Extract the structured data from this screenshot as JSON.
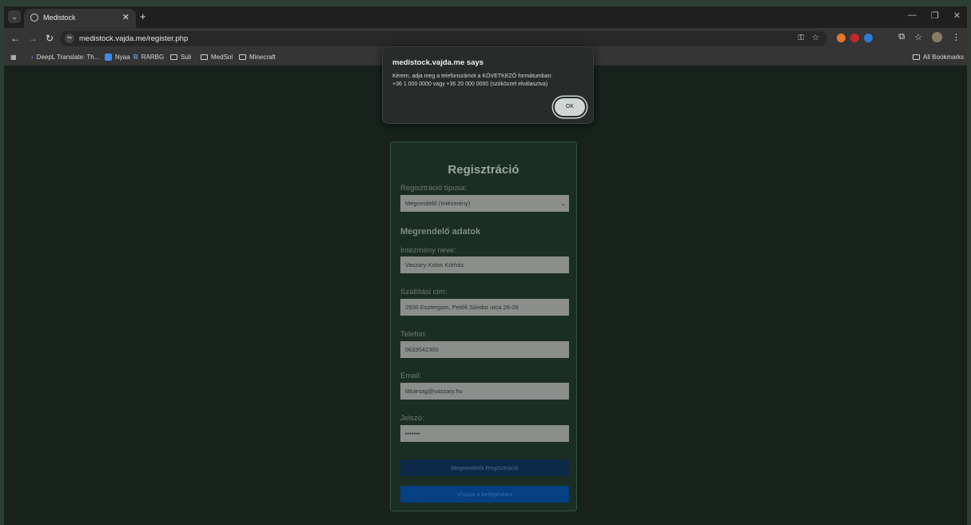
{
  "browser": {
    "tab": {
      "title": "Medistock",
      "close": "✕"
    },
    "new_tab": "+",
    "url": "medistock.vajda.me/register.php",
    "window_controls": [
      "—",
      "❐",
      "✕"
    ],
    "bookmarks": [
      "DeepL Translate: Th...",
      "Nyaa",
      "RARBG",
      "Suli",
      "MedSol",
      "Minecraft"
    ],
    "all_bookmarks": "All Bookmarks"
  },
  "dialog": {
    "title": "medistock.vajda.me says",
    "message_line1": "Kérem, adja meg a telefonszámot a KÖVETKEZŐ formátumban:",
    "message_line2": "+36 1 000 0000 vagy +36 20 000 0000 (szóközzel elválasztva)",
    "ok_label": "OK"
  },
  "form": {
    "title": "Regisztráció",
    "type_label": "Regisztráció típusa:",
    "type_value": "Megrendelő (Intézmény)",
    "section_title": "Megrendelő adatok",
    "institution_label": "Intézmény neve:",
    "institution_value": "Vaszary Kolos Kórház",
    "address_label": "Szállítási cím:",
    "address_value": "2500 Esztergom, Petőfi Sándor utca 26-28",
    "phone_label": "Telefon:",
    "phone_value": "0633542300",
    "email_label": "Email:",
    "email_value": "titkarsag@vaszary.hu",
    "password_label": "Jelszó:",
    "password_value": "•••••••",
    "register_button": "Megrendelői Regisztráció",
    "back_button": "Vissza a belépéshez"
  },
  "colors": {
    "page_bg": "#17221c",
    "card_bg": "#1b2e24",
    "register_btn": "#0d2947",
    "back_btn": "#063f82"
  }
}
